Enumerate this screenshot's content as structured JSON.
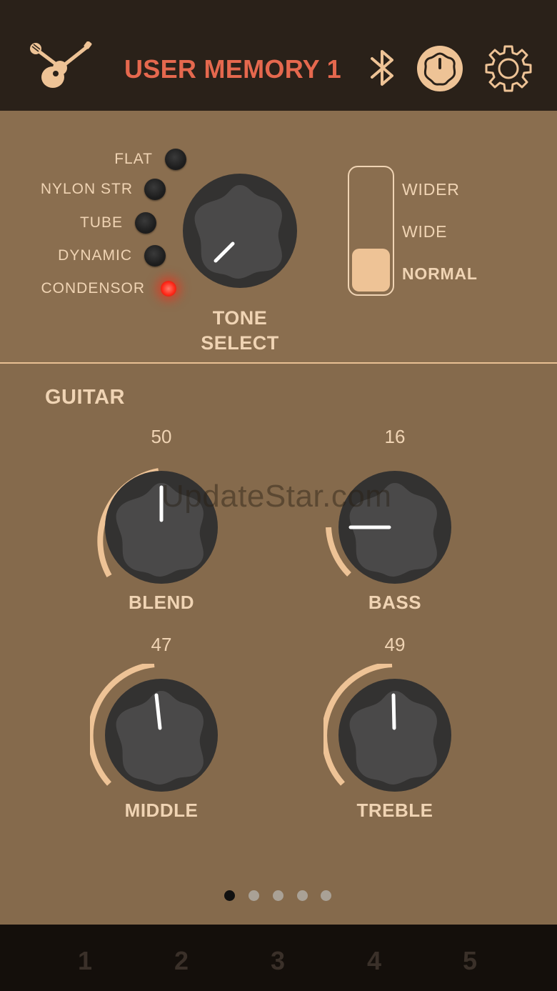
{
  "header": {
    "title": "USER MEMORY 1",
    "mode_icon": "mic-guitar-icon",
    "bluetooth_icon": "bluetooth-icon",
    "knob_icon": "knob-icon",
    "settings_icon": "gear-icon",
    "title_color": "#e5684e"
  },
  "tone": {
    "options": [
      "FLAT",
      "NYLON STR",
      "TUBE",
      "DYNAMIC",
      "CONDENSOR"
    ],
    "selected": "CONDENSOR",
    "knob_label_line1": "TONE",
    "knob_label_line2": "SELECT"
  },
  "width_switch": {
    "options": [
      "WIDER",
      "WIDE",
      "NORMAL"
    ],
    "selected": "NORMAL"
  },
  "guitar": {
    "title": "GUITAR",
    "knobs": [
      {
        "name": "BLEND",
        "value": "50"
      },
      {
        "name": "BASS",
        "value": "16"
      },
      {
        "name": "MIDDLE",
        "value": "47"
      },
      {
        "name": "TREBLE",
        "value": "49"
      }
    ]
  },
  "watermark": "UpdateStar.com",
  "pages": {
    "count": 5,
    "active": 1
  },
  "memory_buttons": [
    "1",
    "2",
    "3",
    "4",
    "5"
  ],
  "colors": {
    "header_bg": "#2a2119",
    "panel_bg": "#856a4c",
    "accent": "#eec396",
    "led_on": "#ff2a1a",
    "bottom_bg": "#140f0b"
  }
}
